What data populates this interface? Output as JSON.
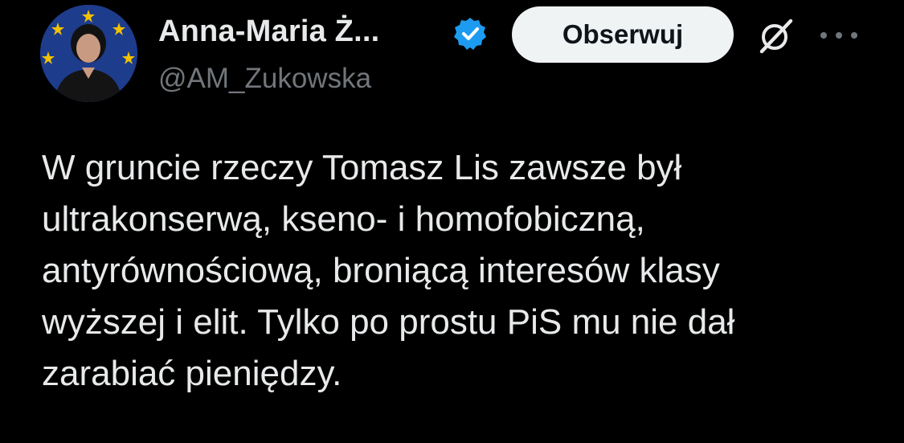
{
  "colors": {
    "background": "#000000",
    "text_primary": "#e7e9ea",
    "text_secondary": "#71767b",
    "verified_blue": "#1d9bf0",
    "follow_bg": "#eff3f4",
    "follow_text": "#0f1419"
  },
  "author": {
    "display_name": "Anna-Maria Ż...",
    "handle": "@AM_Zukowska",
    "verified_icon": "verified-badge-icon",
    "avatar_icon": "profile-avatar"
  },
  "header": {
    "follow_label": "Obserwuj",
    "grok_icon": "grok-icon",
    "more_icon": "more-options-icon"
  },
  "tweet": {
    "lines": [
      "W gruncie rzeczy Tomasz Lis zawsze był",
      "ultrakonserwą, kseno- i homofobiczną,",
      "antyrównościową, broniącą interesów klasy",
      "wyższej i elit. Tylko po prostu PiS mu nie dał",
      "zarabiać pieniędzy."
    ]
  }
}
